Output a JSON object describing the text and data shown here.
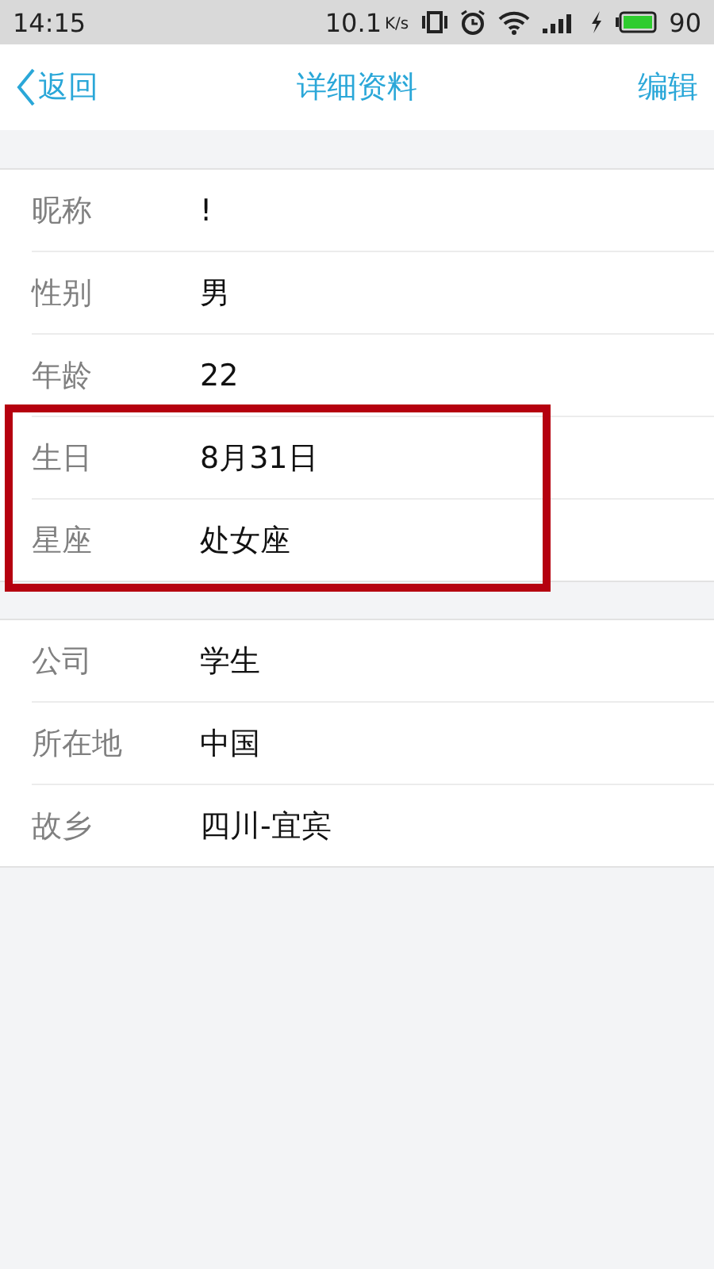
{
  "status_bar": {
    "time": "14:15",
    "speed": "10.1",
    "speed_unit": "K/s",
    "battery": "90"
  },
  "nav": {
    "back": "返回",
    "title": "详细资料",
    "action": "编辑"
  },
  "sections": [
    {
      "rows": [
        {
          "label": "昵称",
          "value": "!",
          "highlighted": false
        },
        {
          "label": "性别",
          "value": "男",
          "highlighted": false
        },
        {
          "label": "年龄",
          "value": "22",
          "highlighted": false
        },
        {
          "label": "生日",
          "value": "8月31日",
          "highlighted": true
        },
        {
          "label": "星座",
          "value": "处女座",
          "highlighted": true
        }
      ]
    },
    {
      "rows": [
        {
          "label": "公司",
          "value": "学生",
          "highlighted": false
        },
        {
          "label": "所在地",
          "value": "中国",
          "highlighted": false
        },
        {
          "label": "故乡",
          "value": "四川-宜宾",
          "highlighted": false
        }
      ]
    }
  ]
}
